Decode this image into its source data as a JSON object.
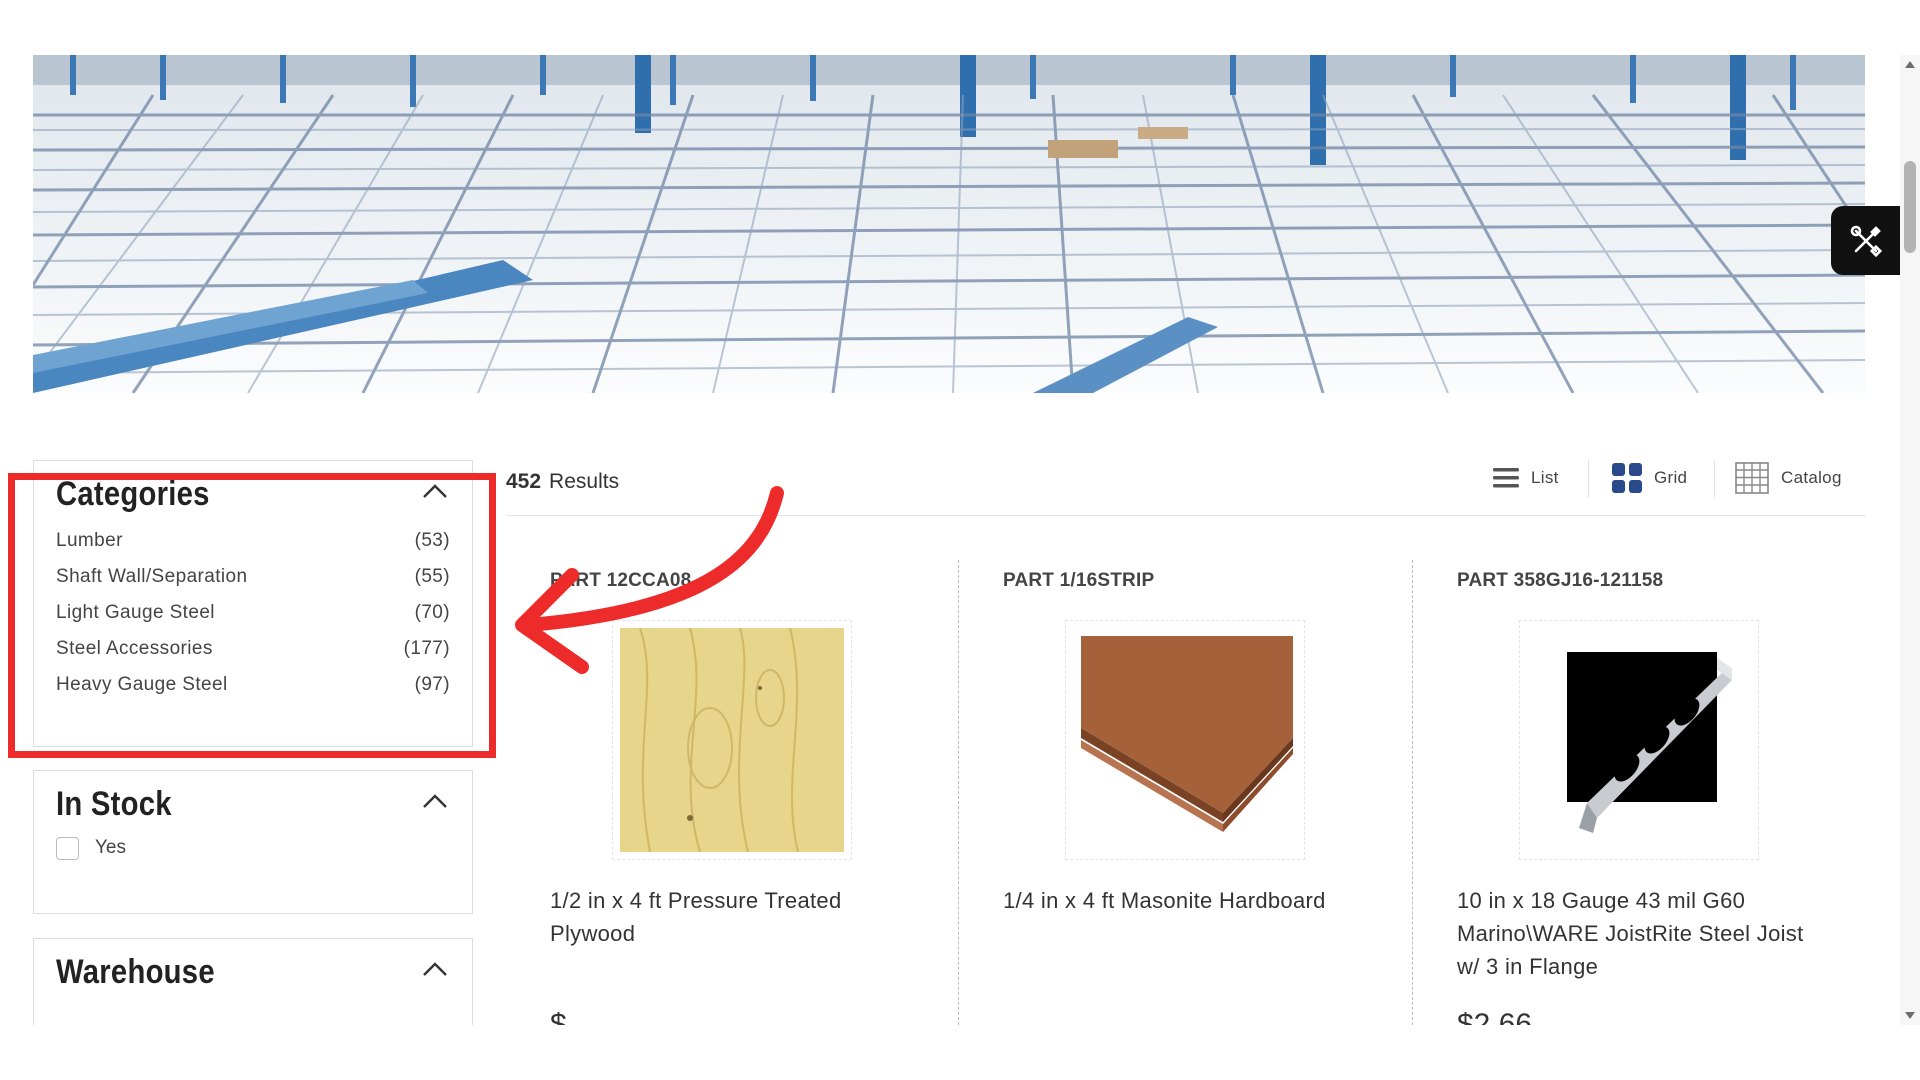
{
  "results": {
    "count": "452",
    "label": "Results"
  },
  "view_options": [
    {
      "label": "List",
      "icon": "list-icon"
    },
    {
      "label": "Grid",
      "icon": "grid-icon"
    },
    {
      "label": "Catalog",
      "icon": "catalog-icon"
    }
  ],
  "filters": {
    "categories": {
      "title": "Categories",
      "items": [
        {
          "name": "Lumber",
          "count": "(53)"
        },
        {
          "name": "Shaft Wall/Separation",
          "count": "(55)"
        },
        {
          "name": "Light Gauge Steel",
          "count": "(70)"
        },
        {
          "name": "Steel Accessories",
          "count": "(177)"
        },
        {
          "name": "Heavy Gauge Steel",
          "count": "(97)"
        }
      ]
    },
    "in_stock": {
      "title": "In Stock",
      "option": "Yes",
      "checked": false
    },
    "warehouse": {
      "title": "Warehouse"
    }
  },
  "products": [
    {
      "part": "PART 12CCA08",
      "name": "1/2 in x 4 ft Pressure Treated Plywood",
      "price": "$"
    },
    {
      "part": "PART 1/16STRIP",
      "name": "1/4 in x 4 ft Masonite Hardboard",
      "price": ""
    },
    {
      "part": "PART 358GJ16-121158",
      "name": "10 in x 18 Gauge 43 mil G60 Marino\\WARE JoistRite Steel Joist w/ 3 in Flange",
      "price": "$2.66"
    }
  ],
  "colors": {
    "highlight": "#ee2b2b",
    "text": "#333333",
    "tool_button": "#111111"
  }
}
